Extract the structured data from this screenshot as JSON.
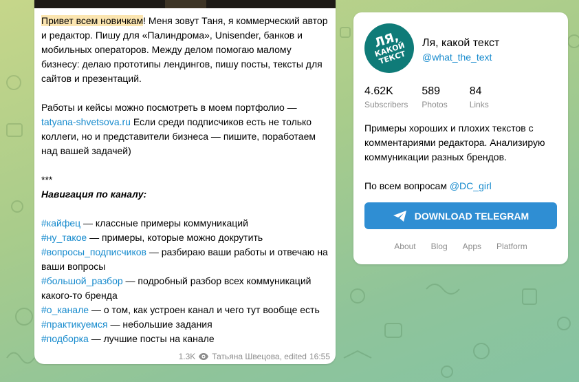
{
  "message": {
    "p1_highlight": "Привет всем новичкам",
    "p1_text": "! Меня зовут Таня, я коммерческий автор и редактор. Пишу для «Палиндрома», Unisender, банков и мобильных операторов. Между делом помогаю малому бизнесу: делаю прототипы лендингов, пишу посты, тексты для сайтов и презентаций.",
    "p2_text": "Работы и кейсы можно посмотреть в моем портфолио —",
    "p2_link": "tatyana-shvetsova.ru",
    "p2_rest": " Если среди подписчиков есть не только коллеги, но и представители бизнеса — пишите, поработаем над вашей задачей)",
    "separator": "***",
    "nav_title": "Навигация по каналу:",
    "tags": [
      {
        "tag": "#кайфец",
        "desc": " — классные примеры коммуникаций"
      },
      {
        "tag": "#ну_такое",
        "desc": " — примеры, которые можно докрутить"
      },
      {
        "tag": "#вопросы_подписчиков",
        "desc": " — разбираю ваши работы и отвечаю на ваши вопросы"
      },
      {
        "tag": "#большой_разбор",
        "desc": " — подробный разбор всех коммуникаций какого-то бренда"
      },
      {
        "tag": "#о_канале",
        "desc": " — о том, как устроен канал и чего тут вообще есть"
      },
      {
        "tag": "#практикуемся",
        "desc": " — небольшие задания"
      },
      {
        "tag": "#подборка",
        "desc": " — лучшие посты на канале"
      }
    ],
    "views": "1.3K",
    "author": "Татьяна Швецова, edited",
    "time": "16:55"
  },
  "channel": {
    "avatar_line1": "ЛЯ,",
    "avatar_line2": "КАКОЙ",
    "avatar_line3": "ТЕКСТ",
    "title": "Ля, какой текст",
    "handle": "@what_the_text",
    "stats": [
      {
        "value": "4.62K",
        "label": "Subscribers"
      },
      {
        "value": "589",
        "label": "Photos"
      },
      {
        "value": "84",
        "label": "Links"
      }
    ],
    "description": "Примеры хороших и плохих текстов с комментариями редактора. Анализирую коммуникации разных брендов.",
    "contact_text": "По всем вопросам ",
    "contact_link": "@DC_girl",
    "download_label": "DOWNLOAD TELEGRAM",
    "footer_links": [
      "About",
      "Blog",
      "Apps",
      "Platform"
    ],
    "accent_color": "#2f8ed3",
    "link_color": "#168acd"
  }
}
